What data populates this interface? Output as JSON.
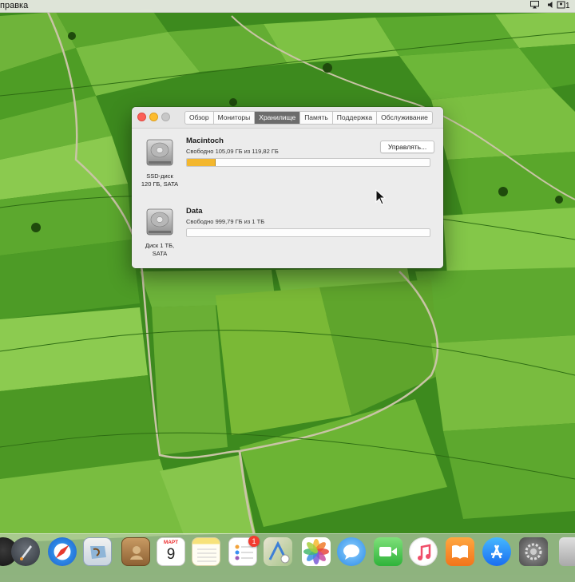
{
  "menubar": {
    "help_label": "правка",
    "clock_fragment": "1"
  },
  "window": {
    "tabs": [
      {
        "label": "Обзор"
      },
      {
        "label": "Мониторы"
      },
      {
        "label": "Хранилище"
      },
      {
        "label": "Память"
      },
      {
        "label": "Поддержка"
      },
      {
        "label": "Обслуживание"
      }
    ],
    "active_tab": "Хранилище",
    "volumes": [
      {
        "name": "Macintoch",
        "free_text": "Свободно 105,09 ГБ из 119,82 ГБ",
        "disk_caption_line1": "SSD-диск",
        "disk_caption_line2": "120 ГБ, SATA",
        "used_fraction": 0.12
      },
      {
        "name": "Data",
        "free_text": "Свободно 999,79 ГБ из 1 ТБ",
        "disk_caption_line1": "Диск 1 ТБ,",
        "disk_caption_line2": "SATA",
        "used_fraction": 0.0
      }
    ],
    "manage_button": "Управлять..."
  },
  "dock": {
    "calendar_month": "МАРТ",
    "calendar_day": "9",
    "reminders_badge": "1",
    "icons": [
      "siri-icon",
      "launchpad-icon",
      "safari-icon",
      "mail-icon",
      "contacts-icon",
      "calendar-icon",
      "notes-icon",
      "reminders-icon",
      "maps-icon",
      "photos-icon",
      "messages-icon",
      "facetime-icon",
      "music-icon",
      "books-icon",
      "app-store-icon",
      "system-preferences-icon",
      "trash-icon"
    ]
  },
  "colors": {
    "accent_storage_used": "#f3b72e",
    "close": "#fc5f57",
    "minimize": "#fdbc2e"
  }
}
